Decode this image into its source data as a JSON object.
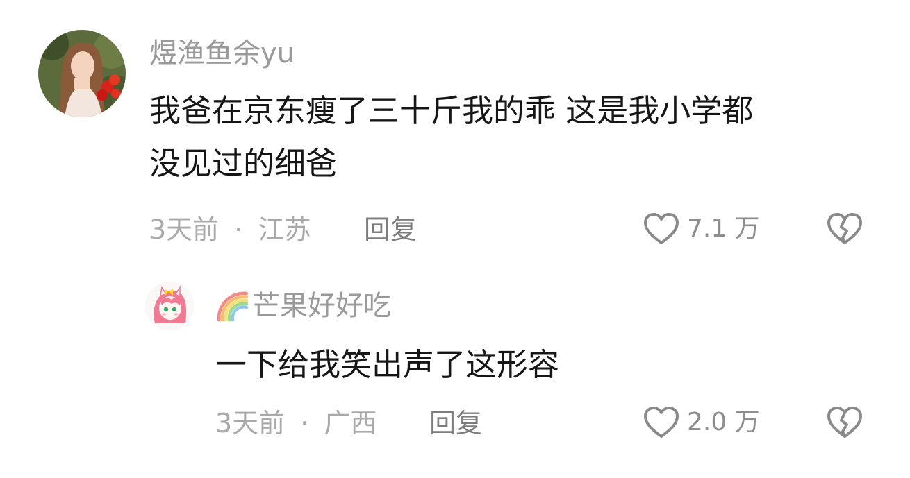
{
  "comments": [
    {
      "username": "煜渔鱼余yu",
      "text_lines": [
        "我爸在京东瘦了三十斤我的乖 这是我小学都",
        "没见过的细爸"
      ],
      "time": "3天前",
      "separator": "·",
      "location": "江苏",
      "reply_label": "回复",
      "like_count": "7.1 万",
      "avatar_icon": "portrait-avatar-icon"
    },
    {
      "username": "芒果好好吃",
      "name_badge_icon": "rainbow-icon",
      "text_lines": [
        "一下给我笑出声了这形容"
      ],
      "time": "3天前",
      "separator": "·",
      "location": "广西",
      "reply_label": "回复",
      "like_count": "2.0 万",
      "avatar_icon": "anime-pony-avatar-icon"
    }
  ],
  "colors": {
    "username": "#9a9a9a",
    "text": "#161616",
    "meta": "#a9a9a9",
    "icon_stroke": "#8a8a8a"
  }
}
